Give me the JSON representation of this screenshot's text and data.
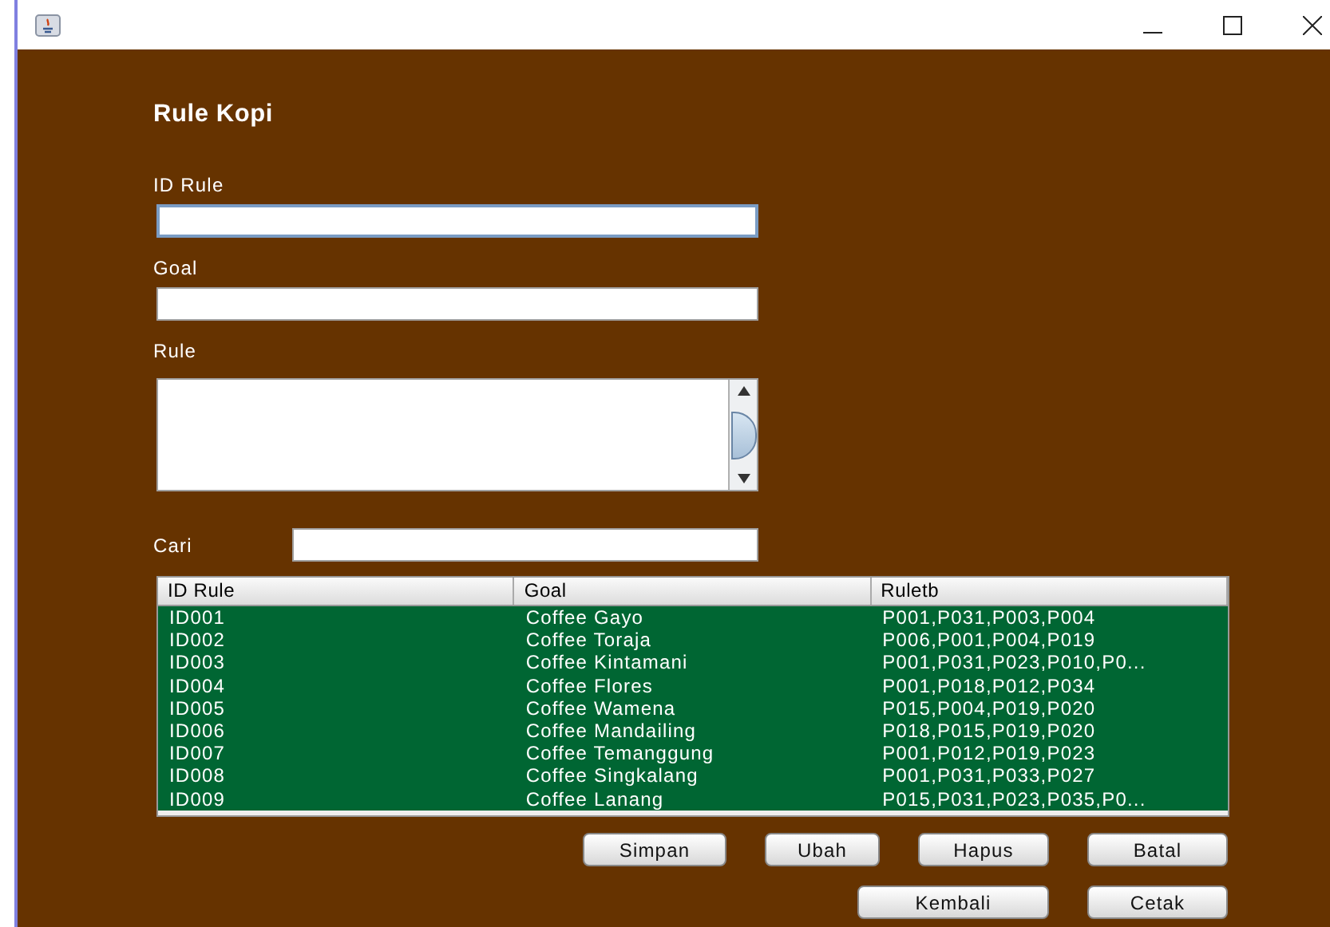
{
  "form": {
    "title": "Rule Kopi",
    "fields": [
      {
        "label": "ID Rule",
        "kind": "text",
        "focused": true
      },
      {
        "label": "Goal",
        "kind": "text",
        "focused": false
      },
      {
        "label": "Rule",
        "kind": "textarea",
        "focused": false
      }
    ],
    "search": {
      "label": "Cari"
    }
  },
  "table": {
    "columns": [
      "ID Rule",
      "Goal",
      "Ruletb"
    ],
    "rows": [
      {
        "cells": [
          "ID001",
          "Coffee Gayo",
          "P001,P031,P003,P004"
        ],
        "selected": true
      },
      {
        "cells": [
          "ID002",
          "Coffee Toraja",
          "P006,P001,P004,P019"
        ],
        "selected": true
      },
      {
        "cells": [
          "ID003",
          "Coffee Kintamani",
          "P001,P031,P023,P010,P0..."
        ],
        "selected": true
      },
      {
        "cells": [
          "ID004",
          "Coffee Flores",
          "P001,P018,P012,P034"
        ],
        "selected": true
      },
      {
        "cells": [
          "ID005",
          "Coffee Wamena",
          "P015,P004,P019,P020"
        ],
        "selected": true
      },
      {
        "cells": [
          "ID006",
          "Coffee Mandailing",
          "P018,P015,P019,P020"
        ],
        "selected": true
      },
      {
        "cells": [
          "ID007",
          "Coffee Temanggung",
          "P001,P012,P019,P023"
        ],
        "selected": true
      },
      {
        "cells": [
          "ID008",
          "Coffee Singkalang",
          "P001,P031,P033,P027"
        ],
        "selected": true
      },
      {
        "cells": [
          "ID009",
          "Coffee Lanang",
          "P015,P031,P023,P035,P0..."
        ],
        "selected": true
      }
    ]
  },
  "buttons": [
    [
      "Simpan",
      "Ubah",
      "Hapus",
      "Batal"
    ],
    [
      "Kembali",
      "Cetak"
    ]
  ]
}
